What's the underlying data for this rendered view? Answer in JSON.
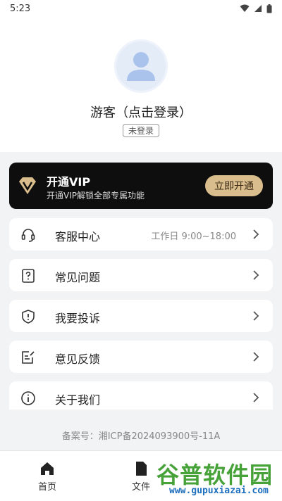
{
  "status_bar": {
    "time": "5:23"
  },
  "profile": {
    "username": "游客（点击登录）",
    "login_status": "未登录"
  },
  "vip": {
    "title": "开通VIP",
    "subtitle": "开通VIP解锁全部专属功能",
    "button_label": "立即开通",
    "accent": "#d9bd8d"
  },
  "menu": {
    "items": [
      {
        "label": "客服中心",
        "extra": "工作日 9:00~18:00",
        "icon": "headset-icon"
      },
      {
        "label": "常见问题",
        "icon": "question-icon"
      },
      {
        "label": "我要投诉",
        "icon": "complaint-icon"
      },
      {
        "label": "意见反馈",
        "icon": "feedback-icon"
      },
      {
        "label": "关于我们",
        "icon": "info-icon"
      }
    ]
  },
  "icp": "备案号：湘ICP备2024093900号-11A",
  "bottom_nav": {
    "tabs": [
      {
        "label": "首页",
        "icon": "home-icon"
      },
      {
        "label": "文件",
        "icon": "file-icon"
      }
    ]
  },
  "watermark": {
    "title": "谷普软件园",
    "url": "www.gupuxiazai.com"
  }
}
